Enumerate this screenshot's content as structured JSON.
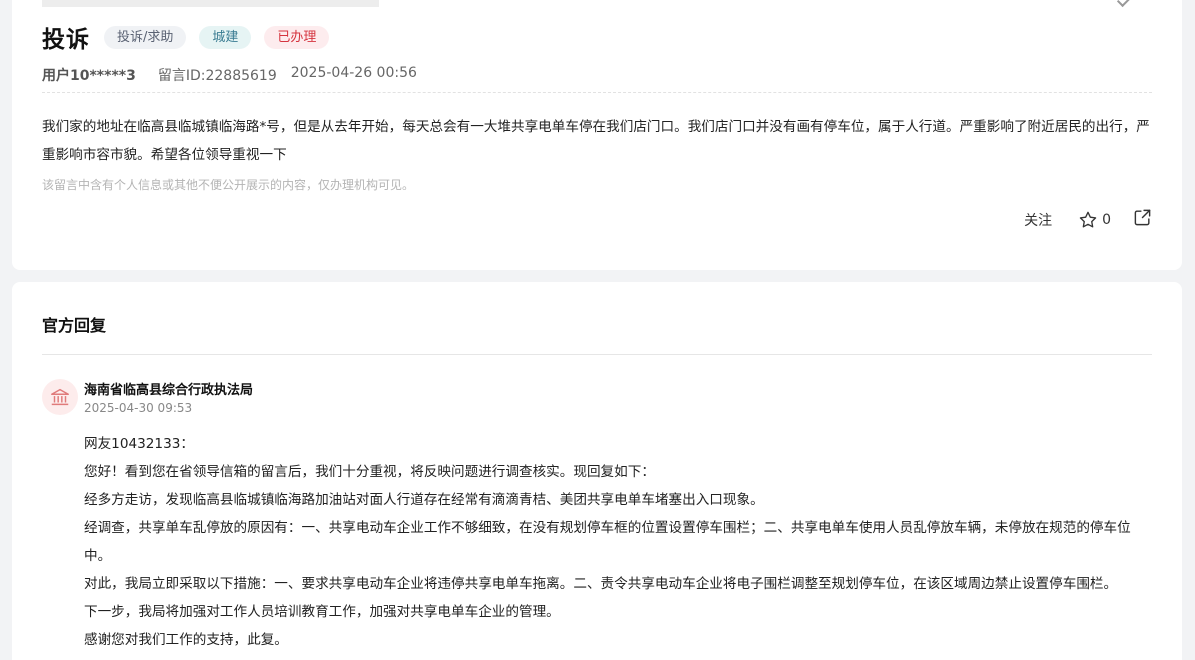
{
  "post": {
    "title": "投诉",
    "tags": [
      "投诉/求助",
      "城建",
      "已办理"
    ],
    "user": "用户10*****3",
    "message_id": "留言ID:22885619",
    "datetime": "2025-04-26 00:56",
    "content": "我们家的地址在临高县临城镇临海路*号，但是从去年开始，每天总会有一大堆共享电单车停在我们店门口。我们店门口并没有画有停车位，属于人行道。严重影响了附近居民的出行，严重影响市容市貌。希望各位领导重视一下",
    "privacy_notice": "该留言中含有个人信息或其他不便公开展示的内容，仅办理机构可见。",
    "actions": {
      "follow_label": "关注",
      "star_count": "0"
    }
  },
  "official_reply": {
    "section_title": "官方回复",
    "org_name": "海南省临高县综合行政执法局",
    "datetime": "2025-04-30 09:53",
    "paragraphs": [
      "网友10432133：",
      "您好！看到您在省领导信箱的留言后，我们十分重视，将反映问题进行调查核实。现回复如下：",
      "经多方走访，发现临高县临城镇临海路加油站对面人行道存在经常有滴滴青桔、美团共享电单车堵塞出入口现象。",
      "经调查，共享单车乱停放的原因有：一、共享电动车企业工作不够细致，在没有规划停车框的位置设置停车围栏；二、共享电单车使用人员乱停放车辆，未停放在规范的停车位中。",
      "对此，我局立即采取以下措施：一、要求共享电动车企业将违停共享电单车拖离。二、责令共享电动车企业将电子围栏调整至规划停车位，在该区域周边禁止设置停车围栏。",
      "下一步，我局将加强对工作人员培训教育工作，加强对共享电单车企业的管理。",
      "感谢您对我们工作的支持，此复。"
    ]
  },
  "icons": {
    "star": "star-icon",
    "share": "share-icon",
    "avatar": "government-building-icon"
  },
  "colors": {
    "tag_done": "#d5343f",
    "tag_category": "#3a7c92",
    "avatar_bg": "#fdecec",
    "avatar_icon": "#e07a7a"
  }
}
